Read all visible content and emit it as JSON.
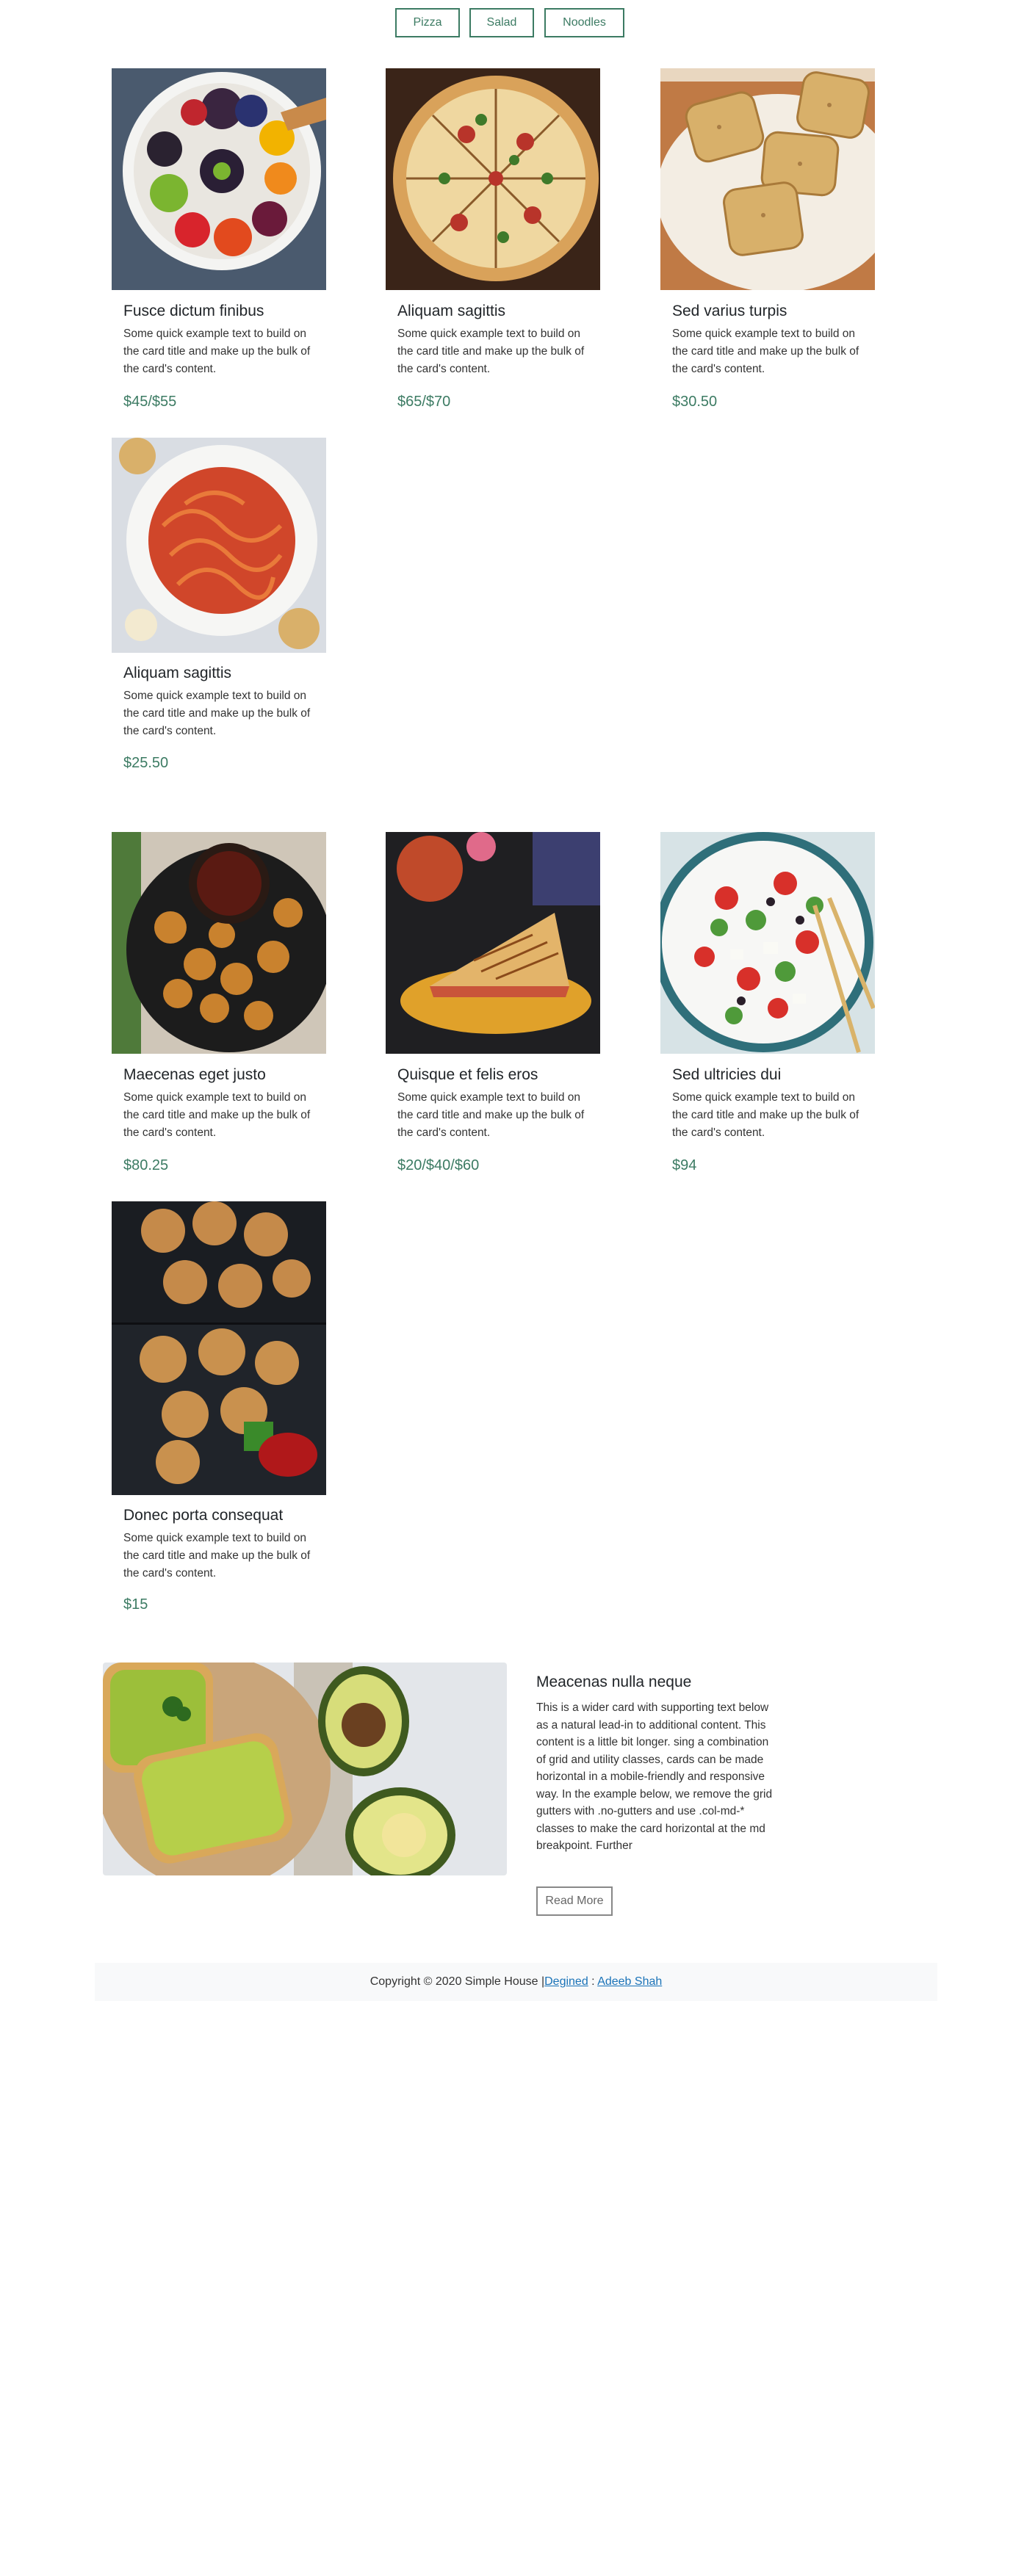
{
  "tabs": [
    "Pizza",
    "Salad",
    "Noodles"
  ],
  "cards_group_1": [
    {
      "title": "Fusce dictum finibus",
      "text": "Some quick example text to build on the card title and make up the bulk of the card's content.",
      "price": "$45/$55",
      "image": "fruit-bowl-photo"
    },
    {
      "title": "Aliquam sagittis",
      "text": "Some quick example text to build on the card title and make up the bulk of the card's content.",
      "price": "$65/$70",
      "image": "pizza-photo"
    },
    {
      "title": "Sed varius turpis",
      "text": "Some quick example text to build on the card title and make up the bulk of the card's content.",
      "price": "$30.50",
      "image": "garlic-bread-photo"
    },
    {
      "title": "Aliquam sagittis",
      "text": "Some quick example text to build on the card title and make up the bulk of the card's content.",
      "price": "$25.50",
      "image": "pasta-photo"
    }
  ],
  "cards_group_2": [
    {
      "title": "Maecenas eget justo",
      "text": "Some quick example text to build on the card title and make up the bulk of the card's content.",
      "price": "$80.25",
      "image": "chicken-nuggets-photo"
    },
    {
      "title": "Quisque et felis eros",
      "text": "Some quick example text to build on the card title and make up the bulk of the card's content.",
      "price": "$20/$40/$60",
      "image": "quesadilla-photo"
    },
    {
      "title": "Sed ultricies dui",
      "text": "Some quick example text to build on the card title and make up the bulk of the card's content.",
      "price": "$94",
      "image": "greek-salad-photo"
    },
    {
      "title": "Donec porta consequat",
      "text": "Some quick example text to build on the card title and make up the bulk of the card's content.",
      "price": "$15",
      "image": "dumplings-photo"
    }
  ],
  "wide_card": {
    "title": "Meacenas nulla neque",
    "text": "This is a wider card with supporting text below as a natural lead-in to additional content. This content is a little bit longer. sing a combination of grid and utility classes, cards can be made horizontal in a mobile-friendly and responsive way. In the example below, we remove the grid gutters with .no-gutters and use .col-md-* classes to make the card horizontal at the md breakpoint. Further",
    "button": "Read More",
    "image": "avocado-toast-photo"
  },
  "footer": {
    "text": "Copyright © 2020 Simple House |",
    "link1": "Degined",
    "separator": " : ",
    "link2": "Adeeb Shah"
  },
  "colors": {
    "accent": "#3c7b63",
    "footer_bg": "#f8f9fa",
    "link": "#1a73b8"
  }
}
